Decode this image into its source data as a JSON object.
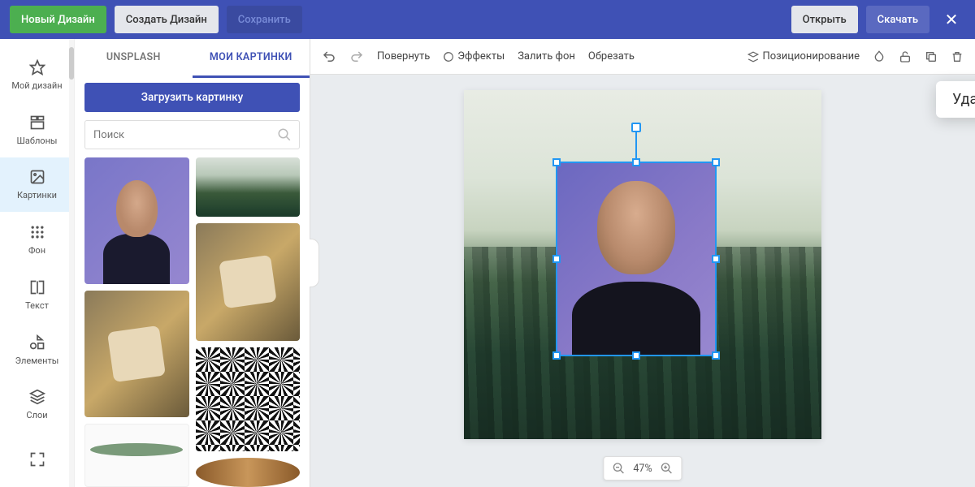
{
  "header": {
    "new_design": "Новый Дизайн",
    "create_design": "Создать Дизайн",
    "save": "Сохранить",
    "open": "Открыть",
    "download": "Скачать"
  },
  "rail": {
    "items": [
      {
        "id": "my-design",
        "label": "Мой дизайн"
      },
      {
        "id": "templates",
        "label": "Шаблоны"
      },
      {
        "id": "images",
        "label": "Картинки"
      },
      {
        "id": "background",
        "label": "Фон"
      },
      {
        "id": "text",
        "label": "Текст"
      },
      {
        "id": "elements",
        "label": "Элементы"
      },
      {
        "id": "layers",
        "label": "Слои"
      }
    ]
  },
  "panel": {
    "tabs": {
      "unsplash": "UNSPLASH",
      "my": "МОИ КАРТИНКИ"
    },
    "upload": "Загрузить картинку",
    "search_placeholder": "Поиск"
  },
  "toolbar": {
    "rotate": "Повернуть",
    "effects": "Эффекты",
    "fill_bg": "Залить фон",
    "crop": "Обрезать",
    "remove_bg_tooltip": "Удалить фон",
    "position": "Позиционирование"
  },
  "zoom": {
    "value": "47%"
  }
}
